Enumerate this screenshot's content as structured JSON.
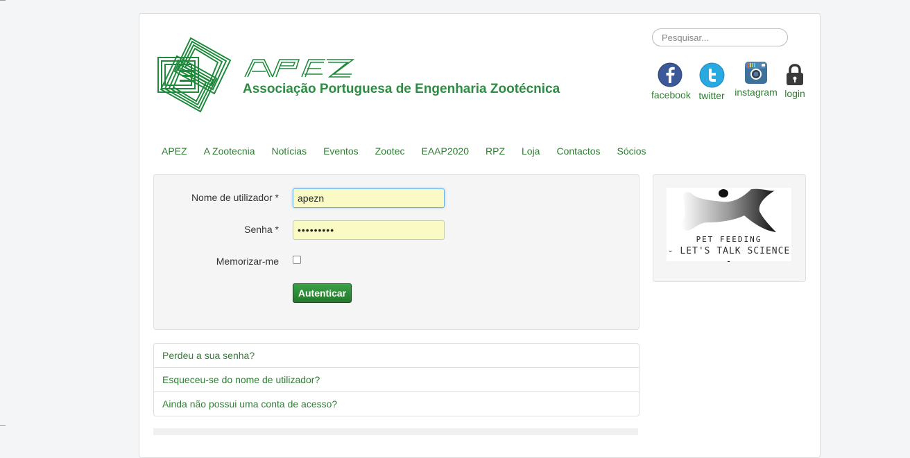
{
  "header": {
    "org_name": "Associação Portuguesa de Engenharia Zootécnica",
    "logo_wordmark": "APEZ",
    "search_placeholder": "Pesquisar..."
  },
  "social": [
    {
      "label": "facebook",
      "icon": "facebook-icon"
    },
    {
      "label": "twitter",
      "icon": "twitter-icon"
    },
    {
      "label": "instagram",
      "icon": "instagram-icon"
    },
    {
      "label": "login",
      "icon": "lock-icon"
    }
  ],
  "nav": {
    "items": [
      "APEZ",
      "A Zootecnia",
      "Notícias",
      "Eventos",
      "Zootec",
      "EAAP2020",
      "RPZ",
      "Loja",
      "Contactos",
      "Sócios"
    ]
  },
  "login": {
    "username_label": "Nome de utilizador *",
    "username_value": "apezn",
    "password_label": "Senha *",
    "password_value": "•••••••••",
    "remember_label": "Memorizar-me",
    "remember_checked": false,
    "submit_label": "Autenticar"
  },
  "links": {
    "items": [
      "Perdeu a sua senha?",
      "Esqueceu-se do nome de utilizador?",
      "Ainda não possui uma conta de acesso?"
    ]
  },
  "sidebar": {
    "banner_line1": "PET FEEDING",
    "banner_line2": "- LET'S TALK SCIENCE -"
  },
  "colors": {
    "brand_green": "#2e8b43",
    "link_green": "#2e7d32",
    "button_green": "#2f8f3a",
    "facebook_blue": "#3b5998",
    "twitter_blue": "#2aa9e0",
    "instagram_blue": "#3f729b"
  }
}
